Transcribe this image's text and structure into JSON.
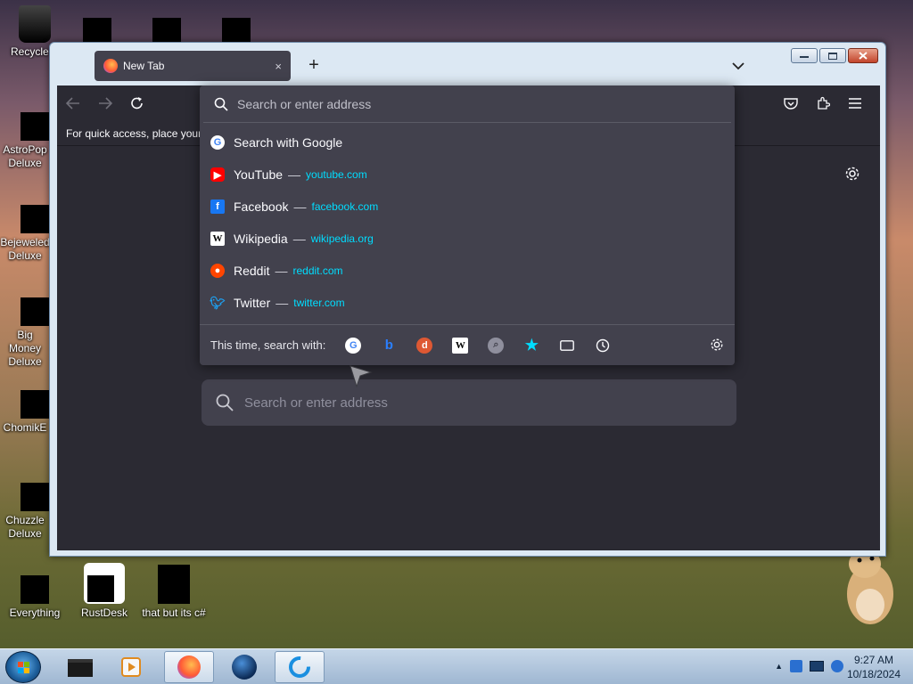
{
  "desktop": {
    "icons": [
      {
        "label": "Recycle B"
      },
      {
        "label": "AstroPop Deluxe"
      },
      {
        "label": "Bejeweled Deluxe"
      },
      {
        "label": "Big Money Deluxe"
      },
      {
        "label": "ChomikE"
      },
      {
        "label": "Chuzzle Deluxe"
      },
      {
        "label": "Everything"
      },
      {
        "label": "RustDesk"
      },
      {
        "label": "that but its c#"
      }
    ]
  },
  "browser": {
    "tab_title": "New Tab",
    "tab_close": "×",
    "new_tab": "+",
    "bookmarks_hint": "For quick access, place your b",
    "urlbar": {
      "placeholder": "Search or enter address",
      "results": [
        {
          "title": "Search with Google",
          "url": "",
          "icon": "google-icon",
          "color": "#ffffff"
        },
        {
          "title": "YouTube",
          "url": "youtube.com",
          "icon": "youtube-icon",
          "color": "#ff0000"
        },
        {
          "title": "Facebook",
          "url": "facebook.com",
          "icon": "facebook-icon",
          "color": "#1877f2"
        },
        {
          "title": "Wikipedia",
          "url": "wikipedia.org",
          "icon": "wikipedia-icon",
          "color": "#ffffff"
        },
        {
          "title": "Reddit",
          "url": "reddit.com",
          "icon": "reddit-icon",
          "color": "#ff4500"
        },
        {
          "title": "Twitter",
          "url": "twitter.com",
          "icon": "twitter-icon",
          "color": "#1da1f2"
        }
      ],
      "separator": "—",
      "search_with_label": "This time, search with:",
      "engines": [
        "google-icon",
        "bing-icon",
        "duckduckgo-icon",
        "wikipedia-icon",
        "search-tabs-icon",
        "bookmarks-star-icon",
        "tabs-icon",
        "history-icon"
      ]
    },
    "page_search_placeholder": "Search or enter address"
  },
  "taskbar": {
    "time": "9:27 AM",
    "date": "10/18/2024"
  }
}
